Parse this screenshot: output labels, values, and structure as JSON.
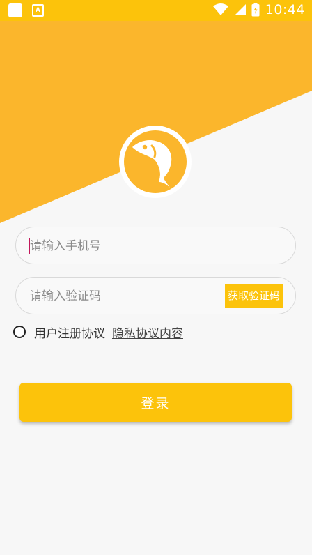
{
  "status_bar": {
    "time": "10:44"
  },
  "login": {
    "phone_placeholder": "请输入手机号",
    "code_placeholder": "请输入验证码",
    "get_code_label": "获取验证码",
    "agreement_label": "用户注册协议",
    "privacy_link": "隐私协议内容",
    "login_label": "登录"
  },
  "colors": {
    "accent": "#fcc30b",
    "header": "#fbb62c",
    "background": "#f7f7f7"
  }
}
